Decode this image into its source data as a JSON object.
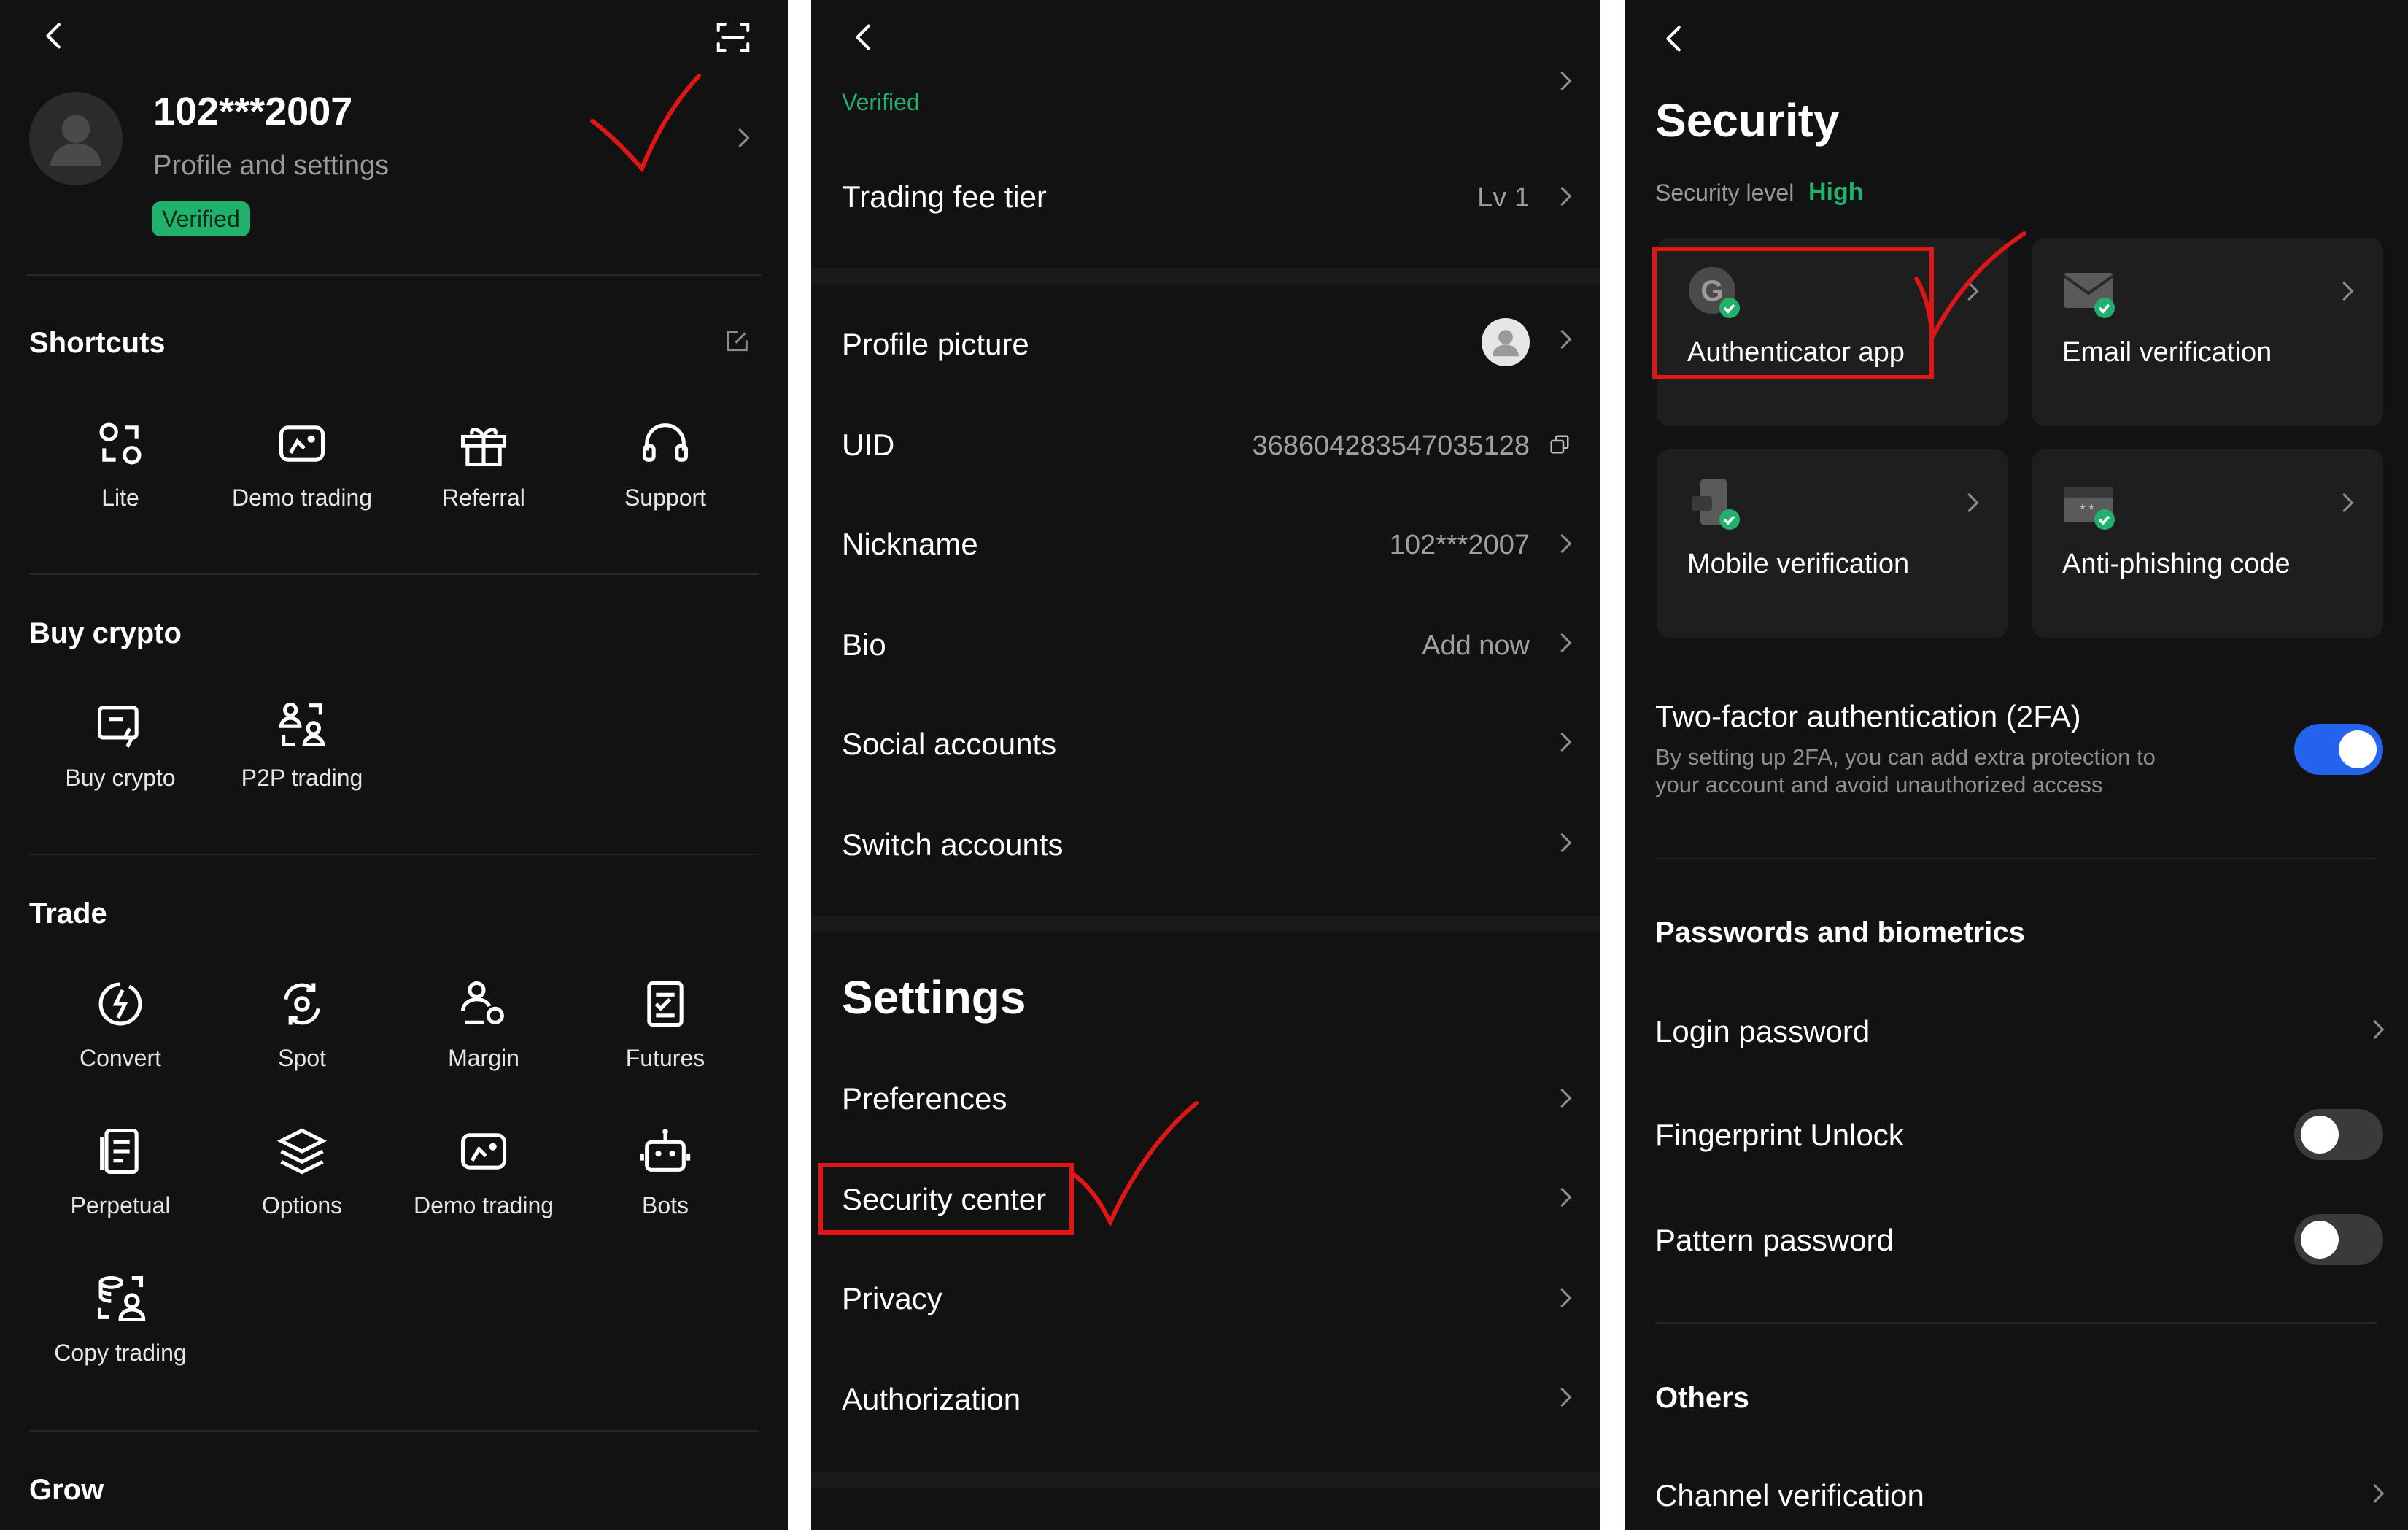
{
  "panel_profile": {
    "username": "102***2007",
    "subtitle": "Profile and settings",
    "verified_badge": "Verified",
    "shortcuts": {
      "title": "Shortcuts",
      "items": [
        {
          "label": "Lite",
          "icon": "lite-icon"
        },
        {
          "label": "Demo trading",
          "icon": "demo-trading-icon"
        },
        {
          "label": "Referral",
          "icon": "gift-icon"
        },
        {
          "label": "Support",
          "icon": "headset-icon"
        }
      ]
    },
    "buy_crypto": {
      "title": "Buy crypto",
      "items": [
        {
          "label": "Buy crypto",
          "icon": "buy-crypto-icon"
        },
        {
          "label": "P2P trading",
          "icon": "p2p-icon"
        }
      ]
    },
    "trade": {
      "title": "Trade",
      "items": [
        {
          "label": "Convert",
          "icon": "convert-icon"
        },
        {
          "label": "Spot",
          "icon": "spot-icon"
        },
        {
          "label": "Margin",
          "icon": "margin-icon"
        },
        {
          "label": "Futures",
          "icon": "futures-icon"
        },
        {
          "label": "Perpetual",
          "icon": "perpetual-icon"
        },
        {
          "label": "Options",
          "icon": "options-icon"
        },
        {
          "label": "Demo trading",
          "icon": "demo-trading-icon"
        },
        {
          "label": "Bots",
          "icon": "bot-icon"
        },
        {
          "label": "Copy trading",
          "icon": "copy-trading-icon"
        }
      ]
    },
    "grow": {
      "title": "Grow"
    }
  },
  "panel_settings": {
    "verified_text": "Verified",
    "rows_top": [
      {
        "label": "Trading fee tier",
        "value": "Lv 1"
      },
      {
        "label": "Profile picture",
        "value": ""
      },
      {
        "label": "UID",
        "value": "368604283547035128"
      },
      {
        "label": "Nickname",
        "value": "102***2007"
      },
      {
        "label": "Bio",
        "value": "Add now"
      },
      {
        "label": "Social accounts",
        "value": ""
      },
      {
        "label": "Switch accounts",
        "value": ""
      }
    ],
    "settings_title": "Settings",
    "rows_settings": [
      {
        "label": "Preferences"
      },
      {
        "label": "Security center"
      },
      {
        "label": "Privacy"
      },
      {
        "label": "Authorization"
      }
    ]
  },
  "panel_security": {
    "title": "Security",
    "level_label": "Security level",
    "level_value": "High",
    "cards": [
      {
        "label": "Authenticator app",
        "icon": "authenticator-icon"
      },
      {
        "label": "Email verification",
        "icon": "email-icon"
      },
      {
        "label": "Mobile verification",
        "icon": "mobile-icon"
      },
      {
        "label": "Anti-phishing code",
        "icon": "anti-phishing-icon"
      }
    ],
    "twofa": {
      "title": "Two-factor authentication (2FA)",
      "description_line1": "By setting up 2FA, you can add extra protection to",
      "description_line2": "your account and avoid unauthorized access",
      "enabled": true
    },
    "passwords_section": "Passwords and biometrics",
    "login_password": "Login password",
    "fingerprint_unlock": {
      "label": "Fingerprint Unlock",
      "enabled": false
    },
    "pattern_password": {
      "label": "Pattern password",
      "enabled": false
    },
    "others_section": "Others",
    "channel_verification": "Channel verification"
  },
  "colors": {
    "background": "#121212",
    "card": "#1e1e1e",
    "accent_green": "#20b26c",
    "toggle_on": "#2463eb",
    "annotation_red": "#e01515"
  }
}
